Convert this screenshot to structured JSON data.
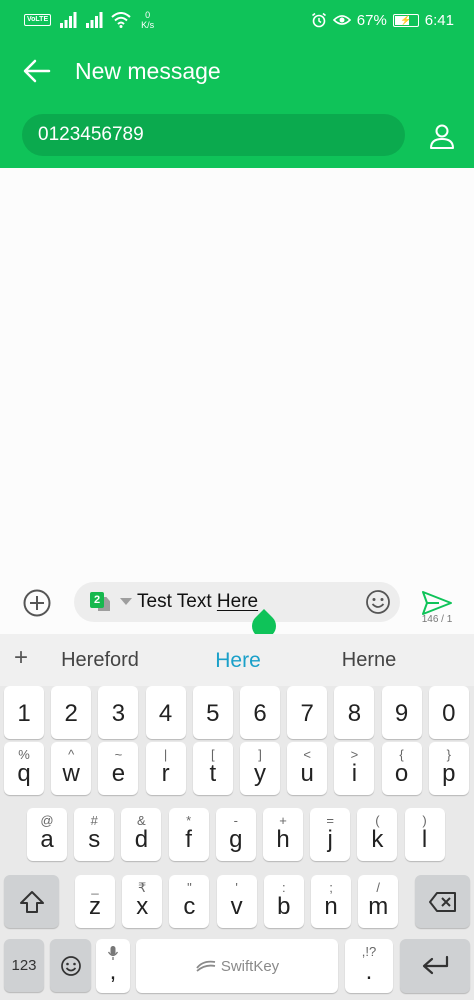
{
  "status_bar": {
    "volte": "VoLTE",
    "speed_value": "0",
    "speed_unit": "K/s",
    "battery": "67%",
    "battery_level": 0.67,
    "time": "6:41"
  },
  "header": {
    "title": "New message",
    "recipient_value": "0123456789"
  },
  "compose": {
    "sim_slot": "2",
    "text_plain": "Test Text ",
    "text_underlined": "Here",
    "char_counter": "146 / 1"
  },
  "keyboard": {
    "suggestions": {
      "plus": "+",
      "left": "Hereford",
      "center": "Here",
      "right": "Herne"
    },
    "number_row": [
      "1",
      "2",
      "3",
      "4",
      "5",
      "6",
      "7",
      "8",
      "9",
      "0"
    ],
    "row1": [
      {
        "main": "q",
        "hint": "%"
      },
      {
        "main": "w",
        "hint": "^"
      },
      {
        "main": "e",
        "hint": "~"
      },
      {
        "main": "r",
        "hint": "|"
      },
      {
        "main": "t",
        "hint": "["
      },
      {
        "main": "y",
        "hint": "]"
      },
      {
        "main": "u",
        "hint": "<"
      },
      {
        "main": "i",
        "hint": ">"
      },
      {
        "main": "o",
        "hint": "{"
      },
      {
        "main": "p",
        "hint": "}"
      }
    ],
    "row2": [
      {
        "main": "a",
        "hint": "@"
      },
      {
        "main": "s",
        "hint": "#"
      },
      {
        "main": "d",
        "hint": "&"
      },
      {
        "main": "f",
        "hint": "*"
      },
      {
        "main": "g",
        "hint": "-"
      },
      {
        "main": "h",
        "hint": "+"
      },
      {
        "main": "j",
        "hint": "="
      },
      {
        "main": "k",
        "hint": "("
      },
      {
        "main": "l",
        "hint": ")"
      }
    ],
    "row3": [
      {
        "main": "z",
        "hint": "_"
      },
      {
        "main": "x",
        "hint": "₹"
      },
      {
        "main": "c",
        "hint": "\""
      },
      {
        "main": "v",
        "hint": "'"
      },
      {
        "main": "b",
        "hint": ":"
      },
      {
        "main": "n",
        "hint": ";"
      },
      {
        "main": "m",
        "hint": "/"
      }
    ],
    "bottom": {
      "symbols": "123",
      "comma": ",",
      "period": ".",
      "period_hint": ",!?",
      "space_brand": "SwiftKey"
    }
  },
  "colors": {
    "accent": "#0fc359",
    "suggestion_highlight": "#1aa0c9"
  },
  "icons": {
    "back": "arrow-left-icon",
    "contact": "person-icon",
    "attach": "plus-circle-icon",
    "emoji": "smiley-icon",
    "send": "send-icon",
    "shift": "shift-arrow-icon",
    "backspace": "backspace-icon",
    "enter": "enter-arrow-icon",
    "mic": "microphone-icon"
  }
}
